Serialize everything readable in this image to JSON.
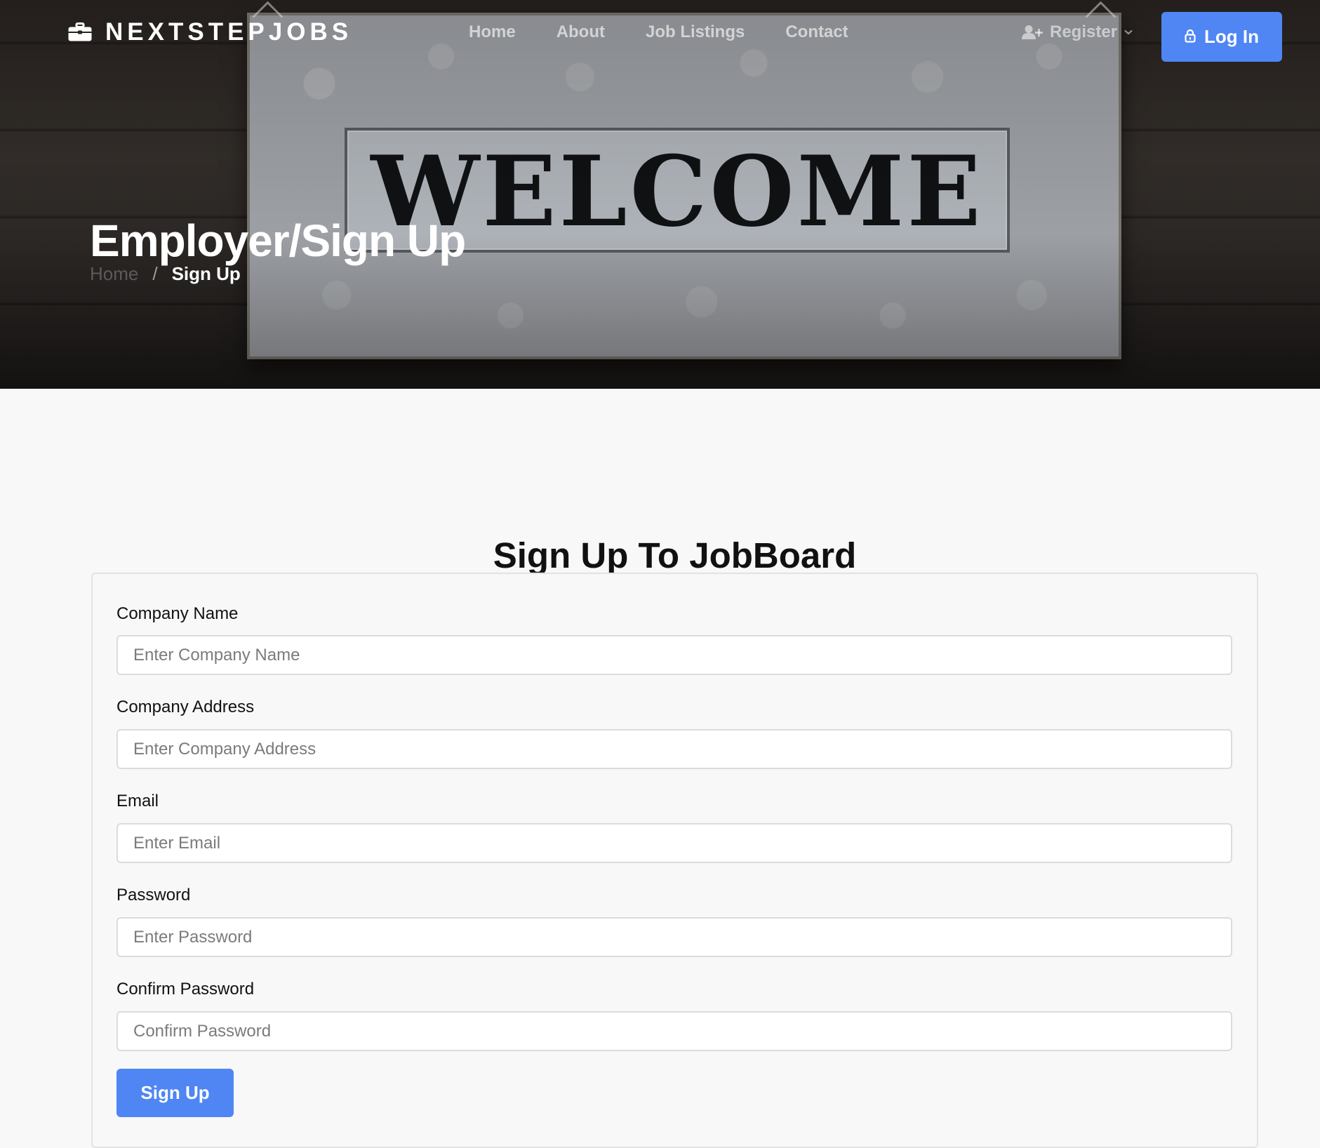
{
  "nav": {
    "brand": "NEXTSTEPJOBS",
    "links": [
      "Home",
      "About",
      "Job Listings",
      "Contact"
    ],
    "register_label": "Register",
    "login_label": "Log In"
  },
  "hero": {
    "sign_text": "WELCOME",
    "page_title": "Employer/Sign Up",
    "breadcrumb": {
      "home": "Home",
      "separator": "/",
      "current": "Sign Up"
    }
  },
  "form": {
    "heading": "Sign Up To JobBoard",
    "fields": [
      {
        "label": "Company Name",
        "placeholder": "Enter Company Name",
        "value": ""
      },
      {
        "label": "Company Address",
        "placeholder": "Enter Company Address",
        "value": ""
      },
      {
        "label": "Email",
        "placeholder": "Enter Email",
        "value": ""
      },
      {
        "label": "Password",
        "placeholder": "Enter Password",
        "value": ""
      },
      {
        "label": "Confirm Password",
        "placeholder": "Confirm Password",
        "value": ""
      }
    ],
    "submit_label": "Sign Up"
  },
  "icons": {
    "brand": "briefcase-icon",
    "register": "user-plus-icon",
    "register_caret": "chevron-down-icon",
    "login": "lock-icon"
  },
  "colors": {
    "primary": "#4f86f4",
    "page_background": "#f8f8f8",
    "hero_background": "#2b2522"
  }
}
